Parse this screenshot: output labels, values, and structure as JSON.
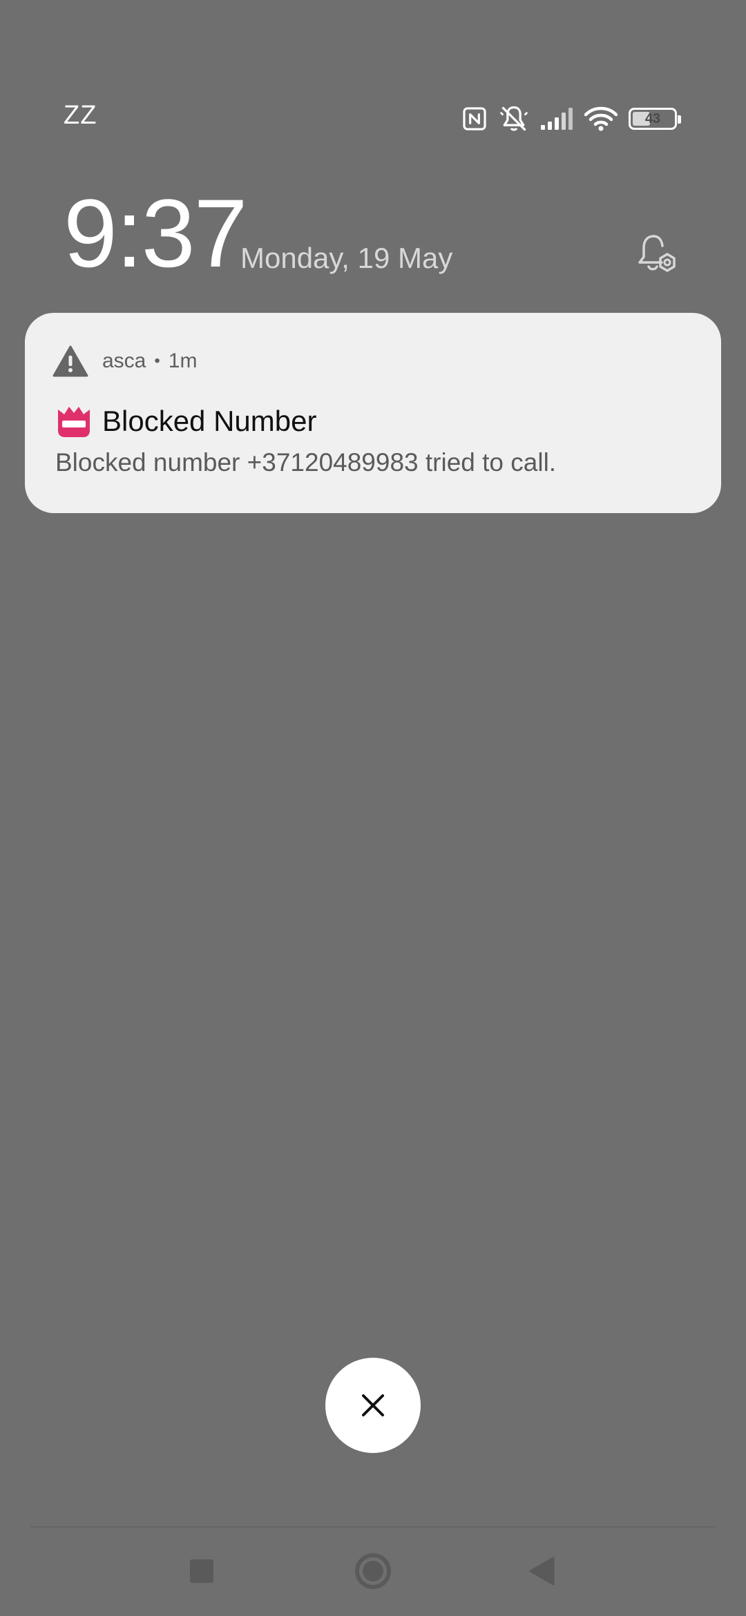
{
  "status_bar": {
    "carrier": "ZZ",
    "battery_level": "43",
    "battery_fraction": 0.43,
    "icons": [
      "nfc-icon",
      "bell-muted-icon",
      "signal-icon",
      "wifi-icon",
      "battery-icon"
    ]
  },
  "lockscreen": {
    "time": "9:37",
    "date": "Monday, 19 May"
  },
  "notification": {
    "app_name": "asca",
    "separator": "•",
    "time_ago": "1m",
    "title": "Blocked Number",
    "body": "Blocked number +37120489983 tried to call.",
    "app_icon": "warning-icon",
    "title_icon": "blocked-number-icon",
    "accent_color": "#e0306c"
  },
  "controls": {
    "dismiss_icon": "close-icon"
  },
  "nav_bar": {
    "items": [
      "recents-button",
      "home-button",
      "back-button"
    ]
  }
}
